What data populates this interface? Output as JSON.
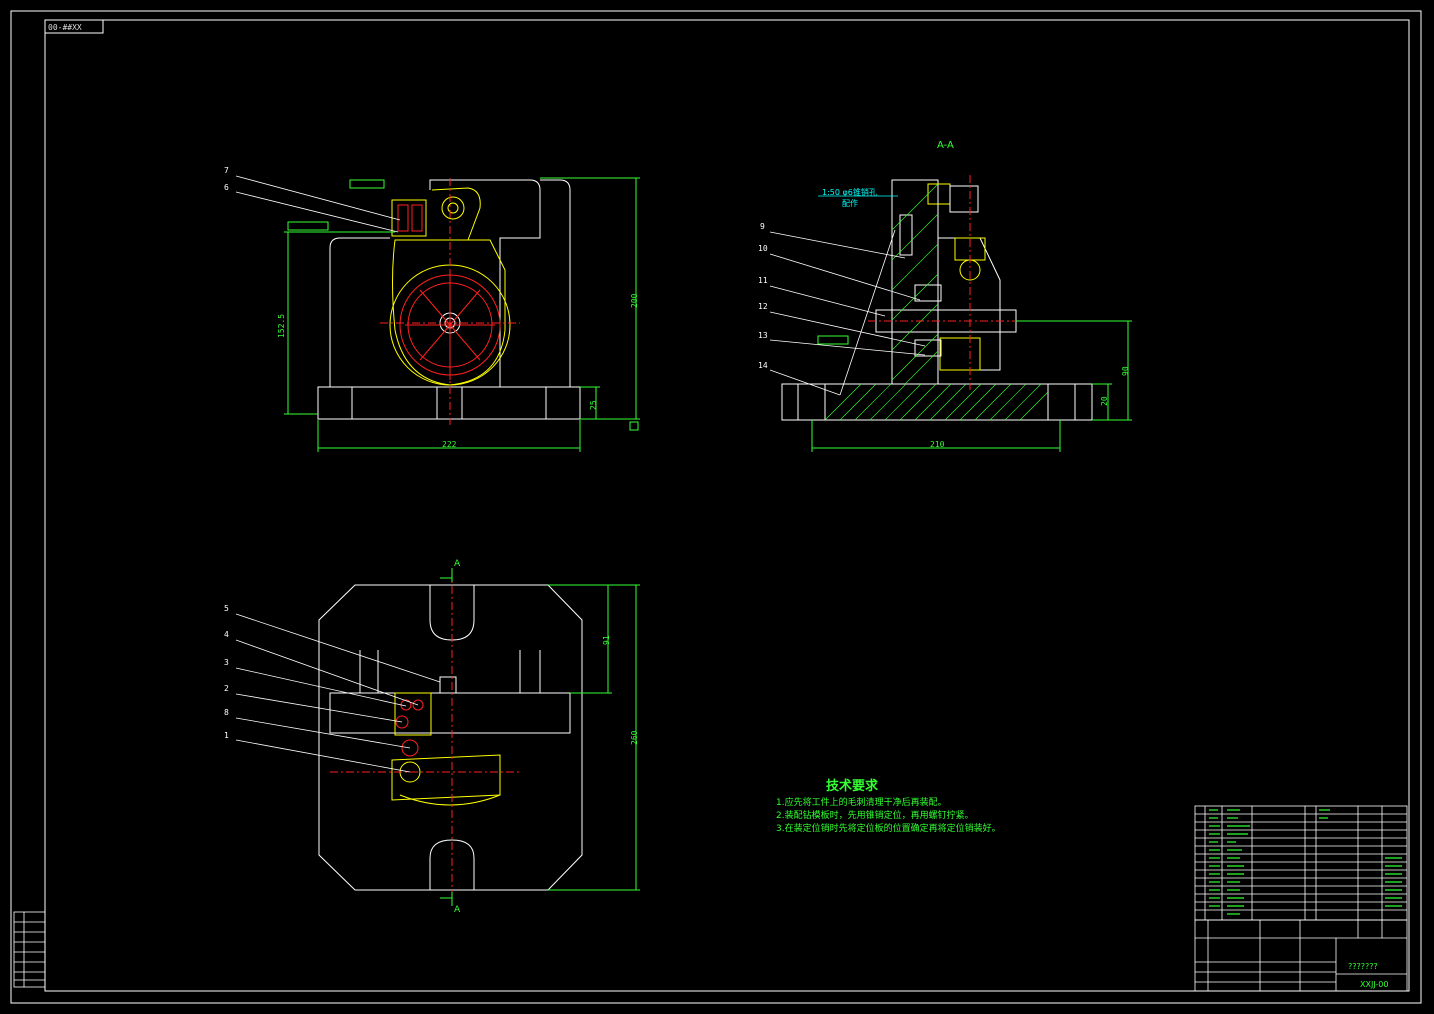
{
  "drawing": {
    "code_tag": "00-##XX",
    "section_title": "A-A",
    "taper_note_line1": "1:50 φ6锥销孔",
    "taper_note_line2": "配作"
  },
  "dimensions": {
    "front_height_overall": "200",
    "front_height_center": "152.5",
    "front_base_height": "25",
    "front_width": "222",
    "section_width": "210",
    "section_height": "90",
    "section_base": "20",
    "plan_height": "260",
    "plan_upper": "91"
  },
  "section_marks": [
    "A",
    "A"
  ],
  "part_numbers_front": [
    "7",
    "6"
  ],
  "part_numbers_section": [
    "9",
    "10",
    "11",
    "12",
    "13",
    "14"
  ],
  "part_numbers_plan": [
    "5",
    "4",
    "3",
    "2",
    "8",
    "1"
  ],
  "tech_requirements": {
    "title": "技术要求",
    "lines": [
      "1.应先将工件上的毛刺清理干净后再装配。",
      "2.装配钻模板时，先用锥销定位，再用螺钉拧紧。",
      "3.在装定位销时先将定位板的位置确定再将定位销装好。"
    ]
  },
  "title_block": {
    "drawing_name": "???????",
    "drawing_number": "XXJJ-00"
  },
  "colors": {
    "background": "#000000",
    "outline": "#ffffff",
    "dimension": "#33ff33",
    "centerline": "#ff2020",
    "hatch": "#33ff33",
    "highlight": "#ffff00",
    "note": "#00ffff"
  }
}
